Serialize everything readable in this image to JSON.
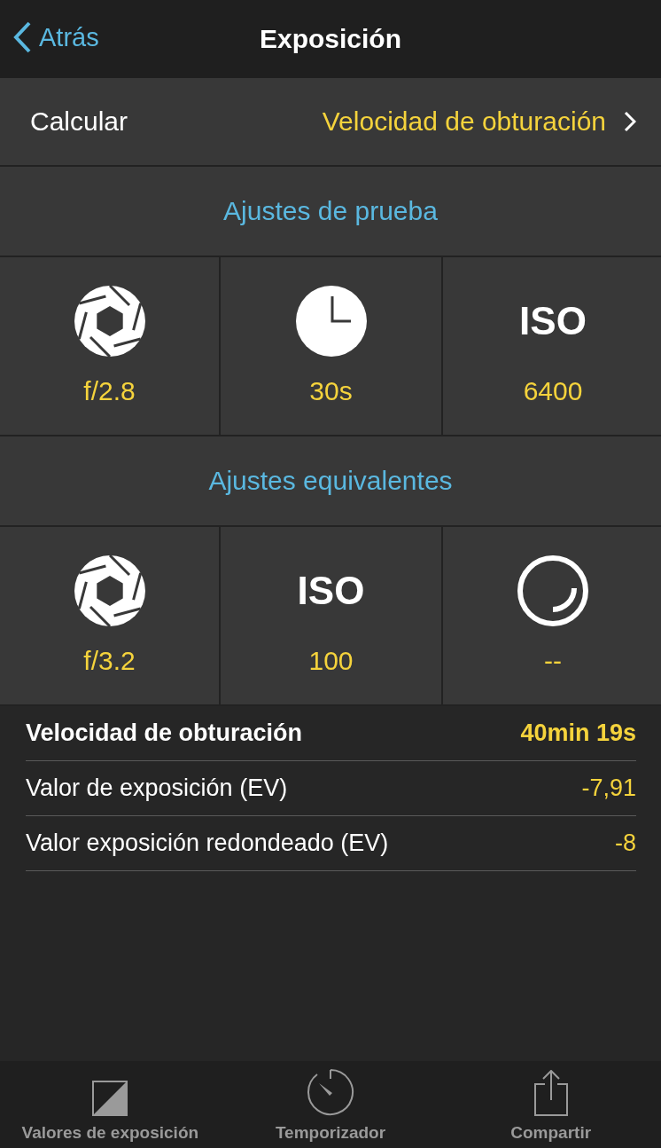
{
  "nav": {
    "back": "Atrás",
    "title": "Exposición"
  },
  "calculate": {
    "label": "Calcular",
    "value": "Velocidad de obturación"
  },
  "sections": [
    {
      "title": "Ajustes de prueba",
      "cells": [
        {
          "kind": "aperture",
          "value": "f/2.8"
        },
        {
          "kind": "clock",
          "value": "30s"
        },
        {
          "kind": "iso",
          "label": "ISO",
          "value": "6400"
        }
      ]
    },
    {
      "title": "Ajustes equivalentes",
      "cells": [
        {
          "kind": "aperture",
          "value": "f/3.2"
        },
        {
          "kind": "iso",
          "label": "ISO",
          "value": "100"
        },
        {
          "kind": "timer",
          "value": "--"
        }
      ]
    }
  ],
  "results": [
    {
      "label": "Velocidad de obturación",
      "value": "40min 19s",
      "bold": true
    },
    {
      "label": "Valor de exposición (EV)",
      "value": "-7,91",
      "bold": false
    },
    {
      "label": "Valor exposición redondeado (EV)",
      "value": "-8",
      "bold": false
    }
  ],
  "tabbar": [
    {
      "kind": "exposure",
      "label": "Valores de exposición"
    },
    {
      "kind": "timer",
      "label": "Temporizador"
    },
    {
      "kind": "share",
      "label": "Compartir"
    }
  ]
}
